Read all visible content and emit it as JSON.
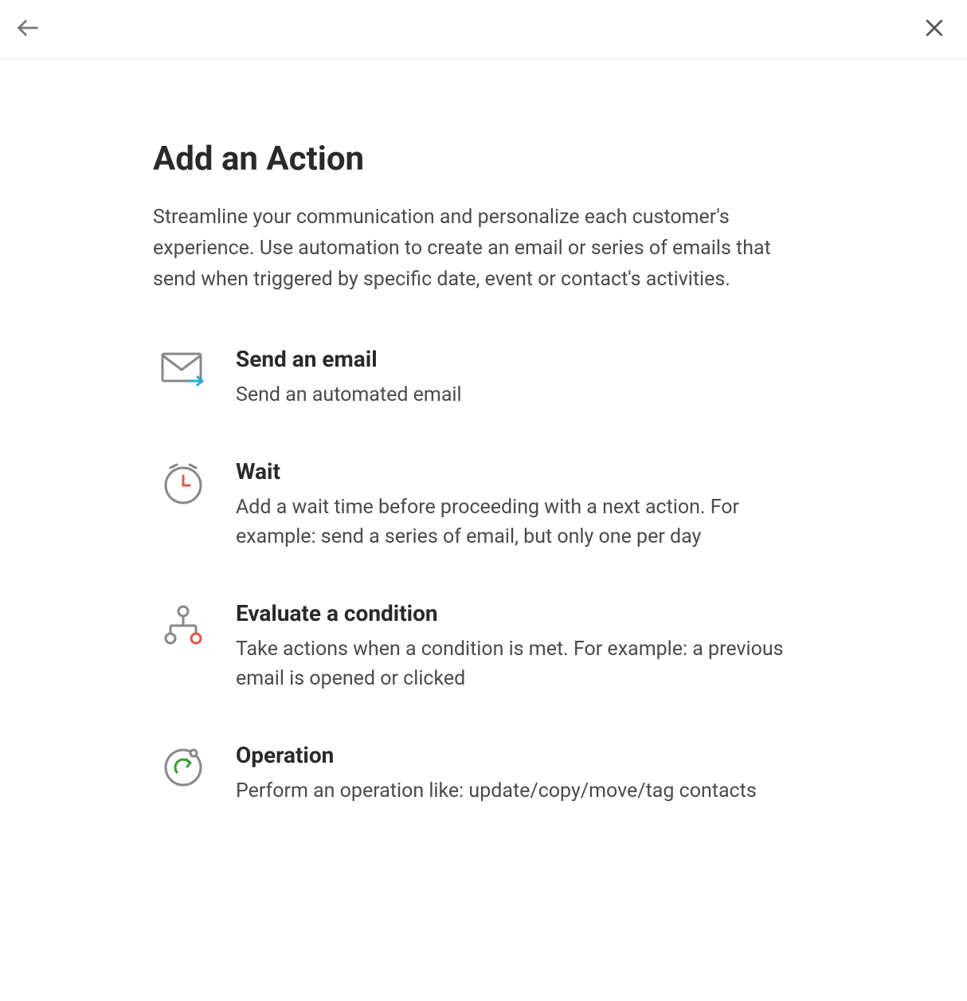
{
  "header": {
    "title": "Add an Action",
    "subtitle": "Streamline your communication and personalize each customer's experience. Use automation to create an email or series of emails that send when triggered by specific date, event or contact's activities."
  },
  "actions": [
    {
      "icon": "email-arrow-icon",
      "title": "Send an email",
      "desc": "Send an automated email"
    },
    {
      "icon": "clock-icon",
      "title": "Wait",
      "desc": "Add a wait time before proceeding with a next action. For example: send a series of email, but only one per day"
    },
    {
      "icon": "branch-icon",
      "title": "Evaluate a condition",
      "desc": "Take actions when a condition is met. For example: a previous email is opened or clicked"
    },
    {
      "icon": "operation-icon",
      "title": "Operation",
      "desc": "Perform an operation like: update/copy/move/tag contacts"
    }
  ]
}
